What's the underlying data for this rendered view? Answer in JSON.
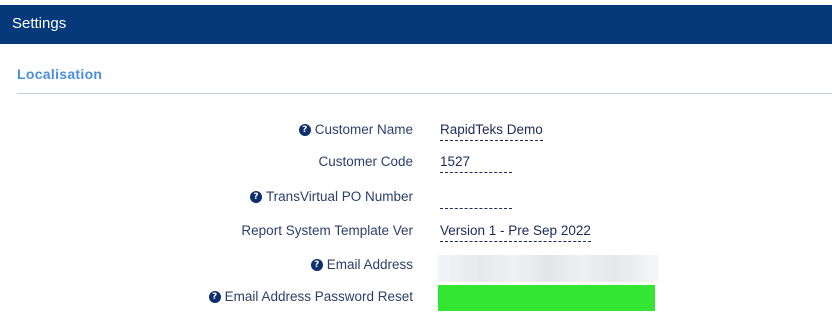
{
  "header": {
    "title": "Settings"
  },
  "section": {
    "title": "Localisation"
  },
  "fields": [
    {
      "label": "Customer Name",
      "value": "RapidTeks Demo",
      "has_help": true
    },
    {
      "label": "Customer Code",
      "value": "1527",
      "has_help": false
    },
    {
      "label": "TransVirtual PO Number",
      "value": "",
      "has_help": true
    },
    {
      "label": "Report System Template Ver",
      "value": "Version 1 - Pre Sep 2022",
      "has_help": false
    },
    {
      "label": "Email Address",
      "value": "",
      "has_help": true
    },
    {
      "label": "Email Address Password Reset",
      "value": "",
      "has_help": true
    }
  ],
  "icons": {
    "help": "question-circle-icon",
    "help_glyph": "?"
  },
  "colors": {
    "header_bg": "#06397a",
    "section_title": "#4a90d9",
    "redaction_green": "#33e632"
  }
}
